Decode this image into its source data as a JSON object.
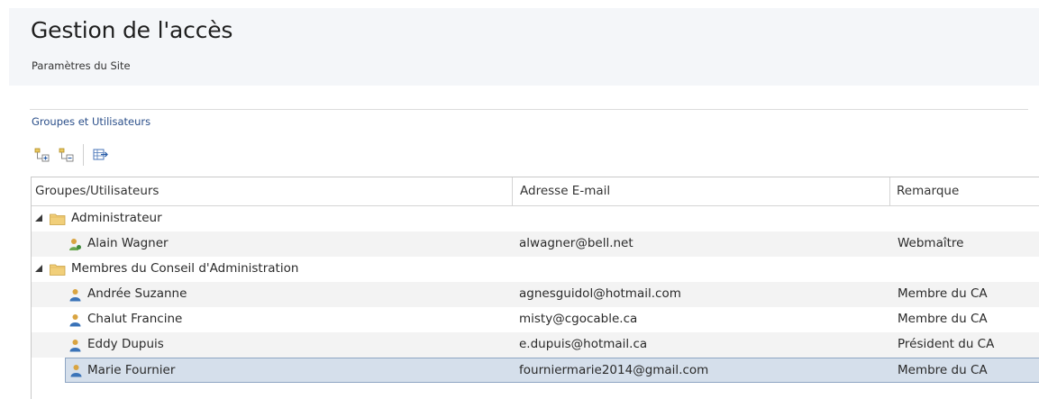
{
  "header": {
    "title": "Gestion de l'accès",
    "subtitle": "Paramètres du Site"
  },
  "section": {
    "title": "Groupes et Utilisateurs"
  },
  "toolbar": {
    "buttons": [
      "expand-all-icon",
      "collapse-all-icon",
      "export-icon"
    ]
  },
  "grid": {
    "columns": [
      "Groupes/Utilisateurs",
      "Adresse E-mail",
      "Remarque"
    ],
    "groups": [
      {
        "name": "Administrateur",
        "expanded": true,
        "users": [
          {
            "name": "Alain Wagner",
            "email": "alwagner@bell.net",
            "remark": "Webmaître",
            "role_icon": "admin-user-icon"
          }
        ]
      },
      {
        "name": "Membres du Conseil d'Administration",
        "expanded": true,
        "users": [
          {
            "name": "Andrée Suzanne",
            "email": "agnesguidol@hotmail.com",
            "remark": "Membre du CA",
            "role_icon": "user-icon"
          },
          {
            "name": "Chalut Francine",
            "email": "misty@cgocable.ca",
            "remark": "Membre du CA",
            "role_icon": "user-icon"
          },
          {
            "name": "Eddy Dupuis",
            "email": "e.dupuis@hotmail.ca",
            "remark": "Président du CA",
            "role_icon": "user-icon"
          },
          {
            "name": "Marie Fournier",
            "email": "fourniermarie2014@gmail.com",
            "remark": "Membre du CA",
            "role_icon": "user-icon",
            "selected": true
          }
        ]
      }
    ]
  },
  "colors": {
    "header_bg": "#f4f6f9",
    "section_title": "#2b4f8a",
    "selected_row_bg": "#d5dfeb",
    "selected_row_border": "#8ea5c3",
    "alt_row_bg": "#f3f3f3"
  }
}
